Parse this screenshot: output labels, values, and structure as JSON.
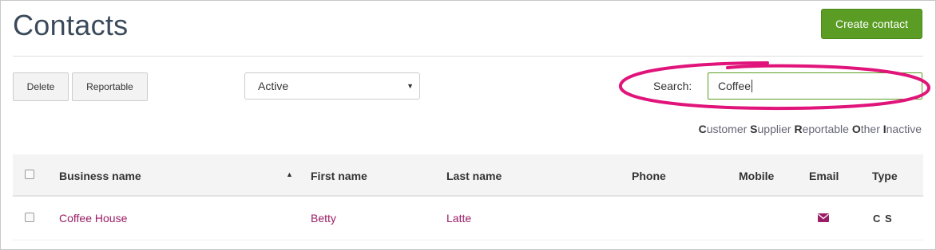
{
  "page": {
    "title": "Contacts",
    "create_button": "Create contact"
  },
  "toolbar": {
    "delete_label": "Delete",
    "reportable_label": "Reportable",
    "status_select": "Active",
    "search_label": "Search:",
    "search_value": "Coffee"
  },
  "filters": [
    {
      "key": "C",
      "rest": "ustomer"
    },
    {
      "key": "S",
      "rest": "upplier"
    },
    {
      "key": "R",
      "rest": "eportable"
    },
    {
      "key": "O",
      "rest": "ther"
    },
    {
      "key": "I",
      "rest": "nactive"
    }
  ],
  "table": {
    "headers": {
      "business_name": "Business name",
      "first_name": "First name",
      "last_name": "Last name",
      "phone": "Phone",
      "mobile": "Mobile",
      "email": "Email",
      "type": "Type"
    },
    "rows": [
      {
        "business_name": "Coffee House",
        "first_name": "Betty",
        "last_name": "Latte",
        "phone": "",
        "mobile": "",
        "email_icon": "envelope-icon",
        "type": "C S"
      }
    ]
  },
  "colors": {
    "primary_button": "#5a9c24",
    "link": "#9a1d66",
    "highlight_oval": "#e0147a"
  }
}
